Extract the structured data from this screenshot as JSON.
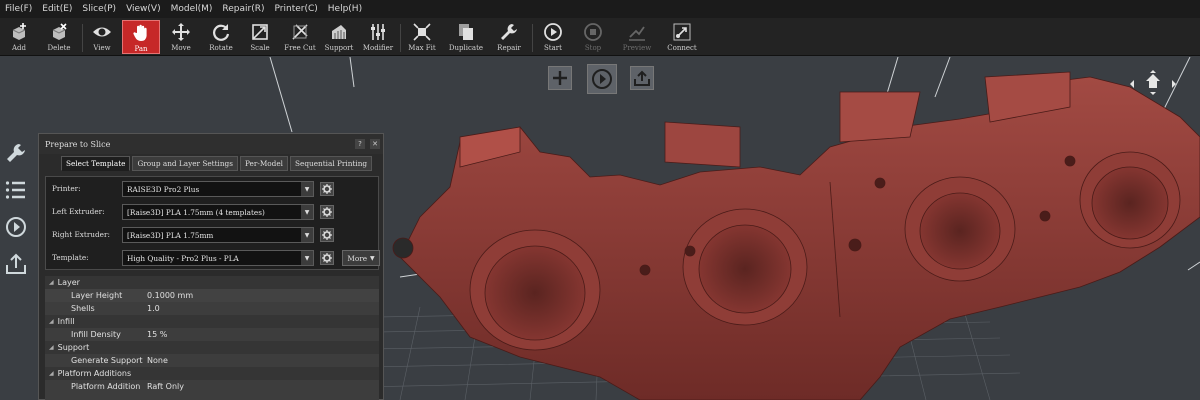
{
  "menu": [
    {
      "label": "File(F)"
    },
    {
      "label": "Edit(E)"
    },
    {
      "label": "Slice(P)"
    },
    {
      "label": "View(V)"
    },
    {
      "label": "Model(M)"
    },
    {
      "label": "Repair(R)"
    },
    {
      "label": "Printer(C)"
    },
    {
      "label": "Help(H)"
    }
  ],
  "toolbar": {
    "add": "Add",
    "delete": "Delete",
    "view": "View",
    "pan": "Pan",
    "move": "Move",
    "rotate": "Rotate",
    "scale": "Scale",
    "free_cut": "Free Cut",
    "support": "Support",
    "modifier": "Modifier",
    "max_fit": "Max Fit",
    "duplicate": "Duplicate",
    "repair": "Repair",
    "start": "Start",
    "stop": "Stop",
    "preview": "Preview",
    "connect": "Connect"
  },
  "dialog": {
    "title": "Prepare to Slice",
    "help": "?",
    "close": "✕",
    "tabs": [
      {
        "label": "Select Template"
      },
      {
        "label": "Group and Layer Settings"
      },
      {
        "label": "Per-Model"
      },
      {
        "label": "Sequential Printing"
      }
    ],
    "fields": {
      "printer": {
        "label": "Printer:",
        "value": "RAISE3D Pro2 Plus"
      },
      "left_extruder": {
        "label": "Left Extruder:",
        "value": "[Raise3D] PLA 1.75mm (4 templates)"
      },
      "right_extruder": {
        "label": "Right Extruder:",
        "value": "[Raise3D] PLA 1.75mm"
      },
      "template": {
        "label": "Template:",
        "value": "High Quality - Pro2 Plus - PLA"
      }
    },
    "more_label": "More",
    "properties": [
      {
        "group": "Layer",
        "items": [
          {
            "key": "Layer Height",
            "value": "0.1000 mm"
          },
          {
            "key": "Shells",
            "value": "1.0"
          }
        ]
      },
      {
        "group": "Infill",
        "items": [
          {
            "key": "Infill Density",
            "value": "15 %"
          }
        ]
      },
      {
        "group": "Support",
        "items": [
          {
            "key": "Generate Support",
            "value": "None"
          }
        ]
      },
      {
        "group": "Platform Additions",
        "items": [
          {
            "key": "Platform Addition",
            "value": "Raft Only"
          }
        ]
      }
    ]
  },
  "colors": {
    "accent_active": "#c62828",
    "model_color": "#8a3b36",
    "viewport_bg": "#3a3e43"
  }
}
